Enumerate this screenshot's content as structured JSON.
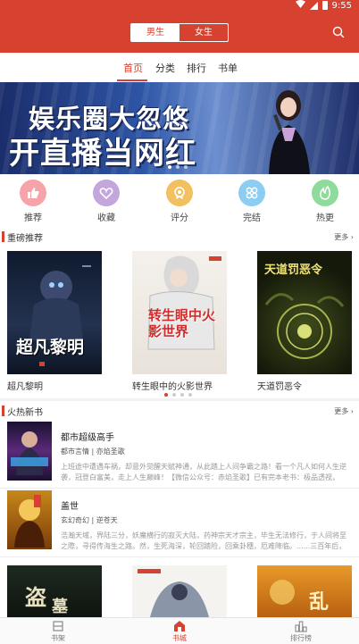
{
  "status": {
    "time": "9:55"
  },
  "header": {
    "gender_tabs": [
      {
        "label": "男生",
        "active": true
      },
      {
        "label": "女生",
        "active": false
      }
    ],
    "search_icon": "search-icon",
    "accent": "#d7412f"
  },
  "tabs": [
    {
      "label": "首页",
      "active": true
    },
    {
      "label": "分类",
      "active": false
    },
    {
      "label": "排行",
      "active": false
    },
    {
      "label": "书单",
      "active": false
    }
  ],
  "banner": {
    "line1": "娱乐圈大忽悠",
    "line2": "开直播当网红",
    "slides": 3,
    "current": 1
  },
  "quick_links": [
    {
      "label": "推荐",
      "icon": "thumbs-up-icon",
      "color": "#f7a3aa"
    },
    {
      "label": "收藏",
      "icon": "heart-icon",
      "color": "#c2a6dc"
    },
    {
      "label": "评分",
      "icon": "badge-icon",
      "color": "#f2c05f"
    },
    {
      "label": "完结",
      "icon": "grid-icon",
      "color": "#8ccdf1"
    },
    {
      "label": "热更",
      "icon": "flame-icon",
      "color": "#8fdb9b"
    }
  ],
  "featured": {
    "title": "重磅推荐",
    "more": "更多",
    "books": [
      {
        "name": "超凡黎明",
        "cover_text": "超凡黎明"
      },
      {
        "name": "转生眼中的火影世界",
        "cover_text": "转生眼中火影世界"
      },
      {
        "name": "天道罚恶令",
        "cover_text": "天道罚恶令"
      }
    ],
    "pages": 4,
    "current_page": 1
  },
  "new_books": {
    "title": "火热新书",
    "more": "更多",
    "items": [
      {
        "title": "都市超级高手",
        "meta": "都市言情 | 亦焰圣歌",
        "desc": "上班途中遭遇车祸，却意外觉醒天赋神通，从此踏上人间争霸之路！看一个凡人如何人生逆袭，冠登白富美，走上人生巅峰！【微信公众号：赤焰圣歌】已有完本老书：极品透视，遗..."
      },
      {
        "title": "盖世",
        "meta": "玄幻奇幻 | 逆苍天",
        "desc": "浩瀚天域，界陆三分，妖魔横行的寂灭大陆，药神宗天才宗主，毕生无法修行，于人间将至之際，寻得传海生之路。然，生死海深，轮回踏险，回乘卦穗，厄难降临。......三百年后，凡..."
      }
    ]
  },
  "bottom_nav": [
    {
      "label": "书架",
      "icon": "bookshelf-icon",
      "active": false
    },
    {
      "label": "书城",
      "icon": "bookstore-icon",
      "active": true
    },
    {
      "label": "排行榜",
      "icon": "ranking-icon",
      "active": false
    }
  ]
}
